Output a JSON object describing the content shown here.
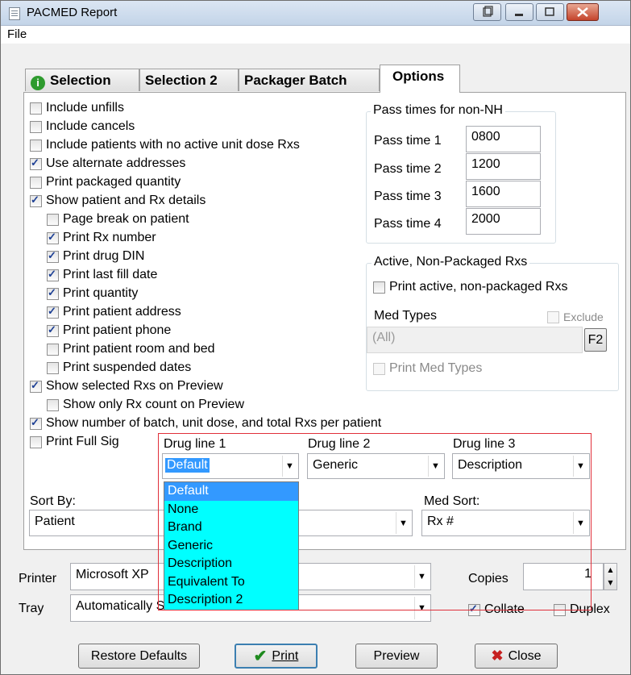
{
  "window": {
    "title": "PACMED Report"
  },
  "menu": {
    "file": "File"
  },
  "tabs": [
    {
      "label": "Selection",
      "icon": "info-icon"
    },
    {
      "label": "Selection 2"
    },
    {
      "label": "Packager Batch"
    },
    {
      "label": "Options"
    }
  ],
  "options": [
    {
      "label": "Include unfills",
      "checked": false
    },
    {
      "label": "Include cancels",
      "checked": false
    },
    {
      "label": "Include patients with no active unit dose Rxs",
      "checked": false
    },
    {
      "label": "Use alternate addresses",
      "checked": true
    },
    {
      "label": "Print packaged quantity",
      "checked": false
    },
    {
      "label": "Show patient and Rx details",
      "checked": true
    },
    {
      "label": "Page break on patient",
      "checked": false
    },
    {
      "label": "Print Rx number",
      "checked": true
    },
    {
      "label": "Print drug DIN",
      "checked": true
    },
    {
      "label": "Print last fill date",
      "checked": true
    },
    {
      "label": "Print quantity",
      "checked": true
    },
    {
      "label": "Print patient address",
      "checked": true
    },
    {
      "label": "Print patient phone",
      "checked": true
    },
    {
      "label": "Print patient room and bed",
      "checked": false
    },
    {
      "label": "Print suspended dates",
      "checked": false
    },
    {
      "label": "Show selected Rxs on Preview",
      "checked": true
    },
    {
      "label": "Show only Rx count on Preview",
      "checked": false
    },
    {
      "label": "Show number of batch, unit dose, and total Rxs per patient",
      "checked": true
    },
    {
      "label": "Print Full Sig",
      "checked": false
    }
  ],
  "pass_times": {
    "title": "Pass times for non-NH",
    "items": [
      {
        "label": "Pass time 1",
        "value": "0800"
      },
      {
        "label": "Pass time 2",
        "value": "1200"
      },
      {
        "label": "Pass time 3",
        "value": "1600"
      },
      {
        "label": "Pass time 4",
        "value": "2000"
      }
    ]
  },
  "active_rxs": {
    "title": "Active, Non-Packaged Rxs",
    "print_active": "Print active, non-packaged Rxs",
    "med_types_label": "Med Types",
    "exclude": "Exclude",
    "med_types_value": "(All)",
    "f2": "F2",
    "print_med_types": "Print Med Types"
  },
  "drug_lines": [
    {
      "label": "Drug line 1",
      "value": "Default"
    },
    {
      "label": "Drug line 2",
      "value": "Generic"
    },
    {
      "label": "Drug line 3",
      "value": "Description"
    }
  ],
  "dropdown_options": [
    "Default",
    "None",
    "Brand",
    "Generic",
    "Description",
    "Equivalent To",
    "Description 2"
  ],
  "sort_by": {
    "label": "Sort By:",
    "value": "Patient"
  },
  "med_sort": {
    "label": "Med Sort:",
    "value": "Rx #"
  },
  "printer": {
    "label": "Printer",
    "value": "Microsoft XP"
  },
  "tray": {
    "label": "Tray",
    "value": "Automatically Select"
  },
  "copies": {
    "label": "Copies",
    "value": "1"
  },
  "collate": {
    "label": "Collate",
    "checked": true
  },
  "duplex": {
    "label": "Duplex",
    "checked": false
  },
  "buttons": {
    "restore": "Restore Defaults",
    "print": "Print",
    "preview": "Preview",
    "close": "Close"
  }
}
